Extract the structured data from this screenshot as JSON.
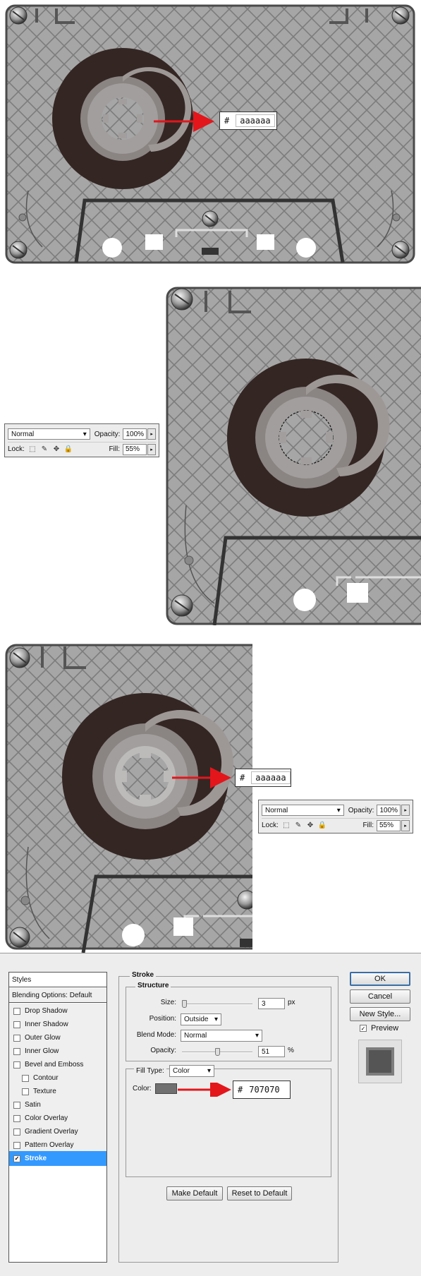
{
  "panel1": {
    "hex_hash": "#",
    "hex_value": "aaaaaa"
  },
  "panel2": {
    "layers": {
      "blend_mode": "Normal",
      "opacity_label": "Opacity:",
      "opacity_value": "100%",
      "lock_label": "Lock:",
      "fill_label": "Fill:",
      "fill_value": "55%"
    }
  },
  "panel3": {
    "hex_hash": "#",
    "hex_value": "aaaaaa",
    "layers": {
      "blend_mode": "Normal",
      "opacity_label": "Opacity:",
      "opacity_value": "100%",
      "lock_label": "Lock:",
      "fill_label": "Fill:",
      "fill_value": "55%"
    }
  },
  "dialog": {
    "styles_header": "Styles",
    "blending_options": "Blending Options: Default",
    "style_items": [
      {
        "label": "Drop Shadow",
        "checked": false
      },
      {
        "label": "Inner Shadow",
        "checked": false
      },
      {
        "label": "Outer Glow",
        "checked": false
      },
      {
        "label": "Inner Glow",
        "checked": false
      },
      {
        "label": "Bevel and Emboss",
        "checked": false
      },
      {
        "label": "Contour",
        "checked": false
      },
      {
        "label": "Texture",
        "checked": false
      },
      {
        "label": "Satin",
        "checked": false
      },
      {
        "label": "Color Overlay",
        "checked": false
      },
      {
        "label": "Gradient Overlay",
        "checked": false
      },
      {
        "label": "Pattern Overlay",
        "checked": false
      },
      {
        "label": "Stroke",
        "checked": true
      }
    ],
    "stroke_title": "Stroke",
    "structure_title": "Structure",
    "size_label": "Size:",
    "size_value": "3",
    "size_unit": "px",
    "position_label": "Position:",
    "position_value": "Outside",
    "blend_mode_label": "Blend Mode:",
    "blend_mode_value": "Normal",
    "opacity_label": "Opacity:",
    "opacity_value": "51",
    "opacity_unit": "%",
    "fill_type_label": "Fill Type:",
    "fill_type_value": "Color",
    "color_label": "Color:",
    "swatch_color": "#707070",
    "hex_hash": "#",
    "hex_value": "707070",
    "make_default": "Make Default",
    "reset_default": "Reset to Default",
    "ok": "OK",
    "cancel": "Cancel",
    "new_style": "New Style...",
    "preview_label": "Preview",
    "preview_checked": true
  },
  "colors": {
    "cassette_body": "#aaaaaa",
    "reel_brown": "#342623",
    "arrow_red": "#e3161c",
    "selection_blue": "#3399ff"
  }
}
